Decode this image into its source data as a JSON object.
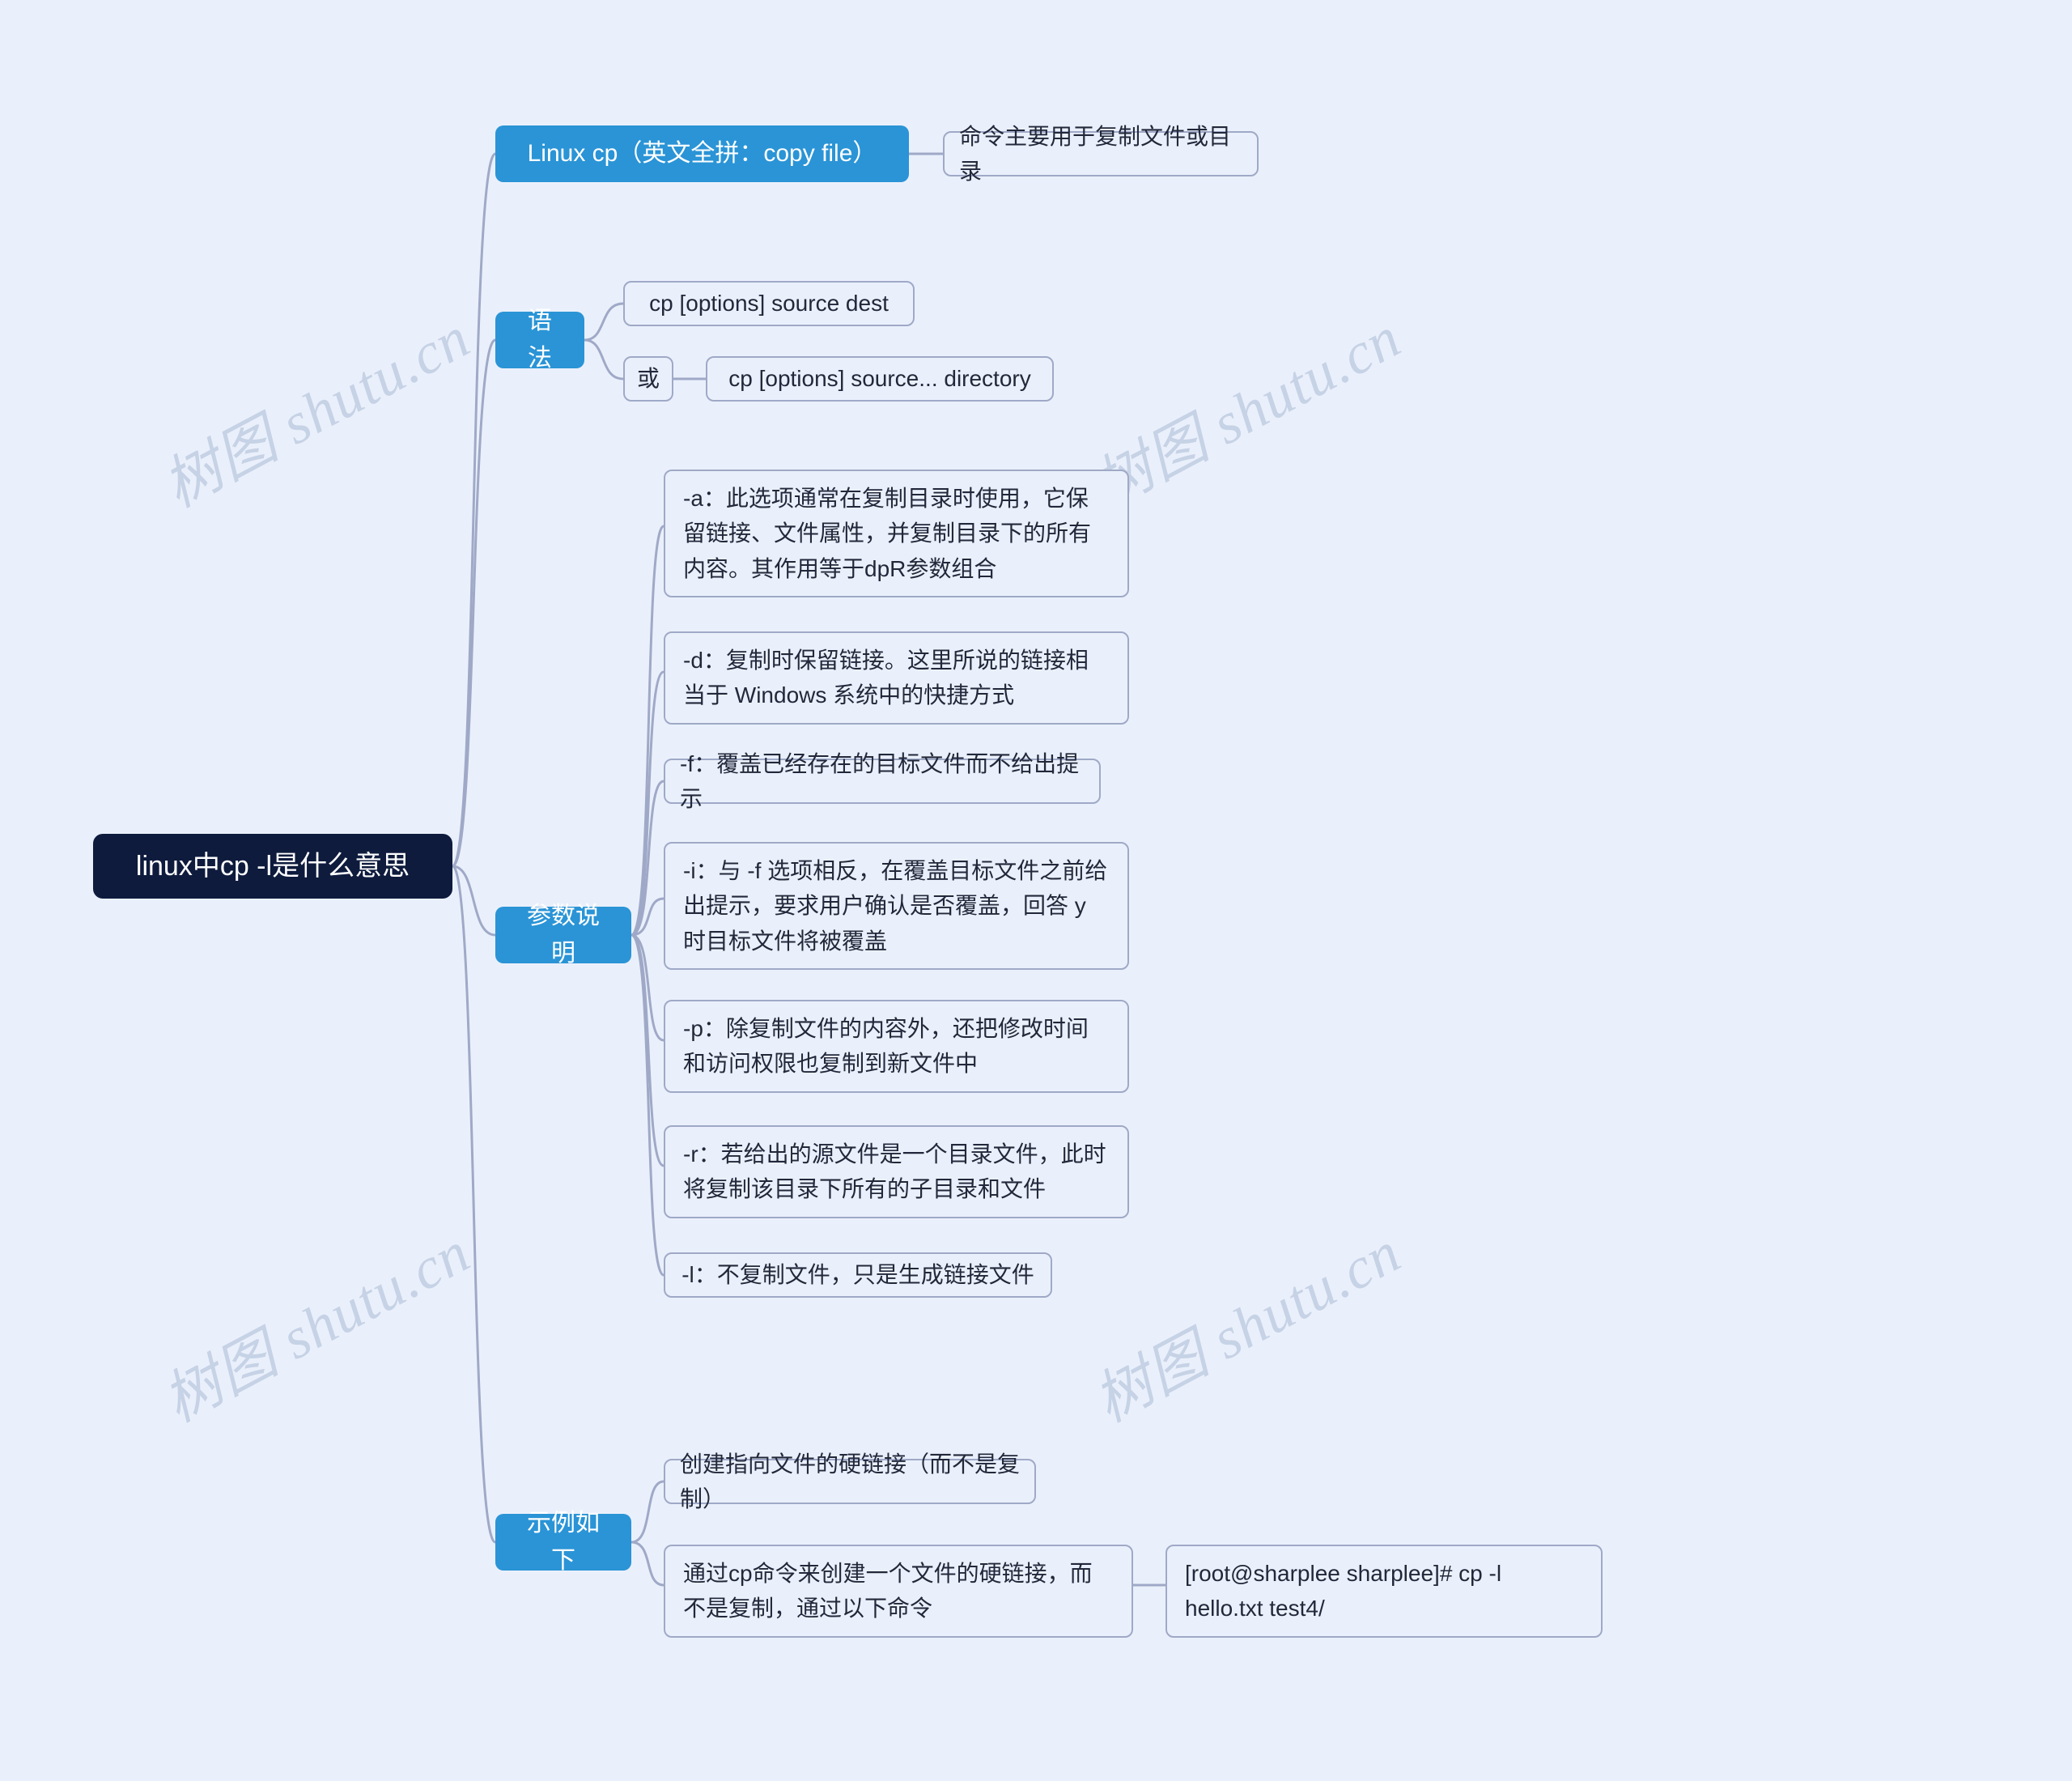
{
  "root": {
    "title": "linux中cp -l是什么意思"
  },
  "branches": {
    "intro": {
      "label": "Linux cp（英文全拼：copy file）",
      "desc": "命令主要用于复制文件或目录"
    },
    "syntax": {
      "label": "语法",
      "line1": "cp [options] source dest",
      "or": "或",
      "line2": "cp [options] source... directory"
    },
    "params": {
      "label": "参数说明",
      "a": "-a：此选项通常在复制目录时使用，它保留链接、文件属性，并复制目录下的所有内容。其作用等于dpR参数组合",
      "d": "-d：复制时保留链接。这里所说的链接相当于 Windows 系统中的快捷方式",
      "f": "-f：覆盖已经存在的目标文件而不给出提示",
      "i": "-i：与 -f 选项相反，在覆盖目标文件之前给出提示，要求用户确认是否覆盖，回答 y 时目标文件将被覆盖",
      "p": "-p：除复制文件的内容外，还把修改时间和访问权限也复制到新文件中",
      "r": "-r：若给出的源文件是一个目录文件，此时将复制该目录下所有的子目录和文件",
      "l": "-l：不复制文件，只是生成链接文件"
    },
    "example": {
      "label": "示例如下",
      "e1": "创建指向文件的硬链接（而不是复制）",
      "e2": "通过cp命令来创建一个文件的硬链接，而不是复制，通过以下命令",
      "cmd": "[root@sharplee sharplee]# cp -l hello.txt test4/"
    }
  },
  "watermark": "树图 shutu.cn"
}
